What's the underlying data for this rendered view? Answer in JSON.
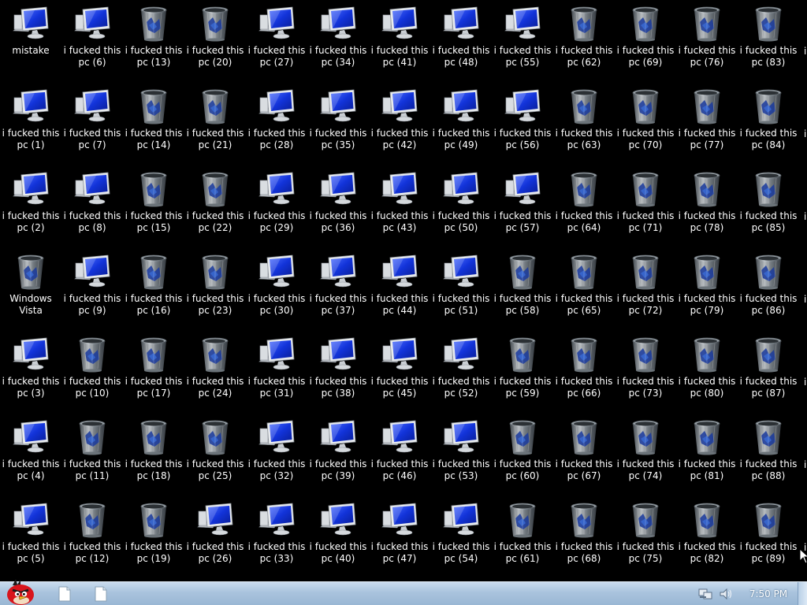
{
  "desktop": {
    "icons": [
      [
        "mistake",
        "i fucked this pc (1)",
        "i fucked this pc (2)",
        "Windows Vista",
        "i fucked this pc (3)",
        "i fucked this pc (4)",
        "i fucked this pc (5)"
      ],
      [
        "i fucked this pc (6)",
        "i fucked this pc (7)",
        "i fucked this pc (8)",
        "i fucked this pc (9)",
        "i fucked this pc (10)",
        "i fucked this pc (11)",
        "i fucked this pc (12)"
      ],
      [
        "i fucked this pc (13)",
        "i fucked this pc (14)",
        "i fucked this pc (15)",
        "i fucked this pc (16)",
        "i fucked this pc (17)",
        "i fucked this pc (18)",
        "i fucked this pc (19)"
      ],
      [
        "i fucked this pc (20)",
        "i fucked this pc (21)",
        "i fucked this pc (22)",
        "i fucked this pc (23)",
        "i fucked this pc (24)",
        "i fucked this pc (25)",
        "i fucked this pc (26)"
      ],
      [
        "i fucked this pc (27)",
        "i fucked this pc (28)",
        "i fucked this pc (29)",
        "i fucked this pc (30)",
        "i fucked this pc (31)",
        "i fucked this pc (32)",
        "i fucked this pc (33)"
      ],
      [
        "i fucked this pc (34)",
        "i fucked this pc (35)",
        "i fucked this pc (36)",
        "i fucked this pc (37)",
        "i fucked this pc (38)",
        "i fucked this pc (39)",
        "i fucked this pc (40)"
      ],
      [
        "i fucked this pc (41)",
        "i fucked this pc (42)",
        "i fucked this pc (43)",
        "i fucked this pc (44)",
        "i fucked this pc (45)",
        "i fucked this pc (46)",
        "i fucked this pc (47)"
      ],
      [
        "i fucked this pc (48)",
        "i fucked this pc (49)",
        "i fucked this pc (50)",
        "i fucked this pc (51)",
        "i fucked this pc (52)",
        "i fucked this pc (53)",
        "i fucked this pc (54)"
      ],
      [
        "i fucked this pc (55)",
        "i fucked this pc (56)",
        "i fucked this pc (57)",
        "i fucked this pc (58)",
        "i fucked this pc (59)",
        "i fucked this pc (60)",
        "i fucked this pc (61)"
      ],
      [
        "i fucked this pc (62)",
        "i fucked this pc (63)",
        "i fucked this pc (64)",
        "i fucked this pc (65)",
        "i fucked this pc (66)",
        "i fucked this pc (67)",
        "i fucked this pc (68)"
      ],
      [
        "i fucked this pc (69)",
        "i fucked this pc (70)",
        "i fucked this pc (71)",
        "i fucked this pc (72)",
        "i fucked this pc (73)",
        "i fucked this pc (74)",
        "i fucked this pc (75)"
      ],
      [
        "i fucked this pc (76)",
        "i fucked this pc (77)",
        "i fucked this pc (78)",
        "i fucked this pc (79)",
        "i fucked this pc (80)",
        "i fucked this pc (81)",
        "i fucked this pc (82)"
      ],
      [
        "i fucked this pc (83)",
        "i fucked this pc (84)",
        "i fucked this pc (85)",
        "i fucked this pc (86)",
        "i fucked this pc (87)",
        "i fucked this pc (88)",
        "i fucked this pc (89)"
      ]
    ],
    "icon_types": [
      [
        "computer",
        "computer",
        "computer",
        "recycle-bin",
        "computer",
        "computer",
        "computer"
      ],
      [
        "computer",
        "computer",
        "computer",
        "computer",
        "recycle-bin",
        "recycle-bin",
        "recycle-bin"
      ],
      [
        "recycle-bin",
        "recycle-bin",
        "recycle-bin",
        "recycle-bin",
        "recycle-bin",
        "recycle-bin",
        "recycle-bin"
      ],
      [
        "recycle-bin",
        "recycle-bin",
        "recycle-bin",
        "recycle-bin",
        "recycle-bin",
        "recycle-bin",
        "computer"
      ],
      [
        "computer",
        "computer",
        "computer",
        "computer",
        "computer",
        "computer",
        "computer"
      ],
      [
        "computer",
        "computer",
        "computer",
        "computer",
        "computer",
        "computer",
        "computer"
      ],
      [
        "computer",
        "computer",
        "computer",
        "computer",
        "computer",
        "computer",
        "computer"
      ],
      [
        "computer",
        "computer",
        "computer",
        "computer",
        "computer",
        "computer",
        "computer"
      ],
      [
        "computer",
        "computer",
        "computer",
        "recycle-bin",
        "recycle-bin",
        "recycle-bin",
        "recycle-bin"
      ],
      [
        "recycle-bin",
        "recycle-bin",
        "recycle-bin",
        "recycle-bin",
        "recycle-bin",
        "recycle-bin",
        "recycle-bin"
      ],
      [
        "recycle-bin",
        "recycle-bin",
        "recycle-bin",
        "recycle-bin",
        "recycle-bin",
        "recycle-bin",
        "recycle-bin"
      ],
      [
        "recycle-bin",
        "recycle-bin",
        "recycle-bin",
        "recycle-bin",
        "recycle-bin",
        "recycle-bin",
        "recycle-bin"
      ],
      [
        "recycle-bin",
        "recycle-bin",
        "recycle-bin",
        "recycle-bin",
        "recycle-bin",
        "recycle-bin",
        "recycle-bin"
      ]
    ],
    "edge_labels": [
      "i",
      "i",
      "i",
      "i",
      "i",
      "i",
      "i"
    ]
  },
  "taskbar": {
    "start_icon": "angry-bird-red-icon",
    "pinned": [
      "document-icon",
      "document-icon"
    ],
    "tray_icons": [
      "network-icon",
      "volume-icon"
    ],
    "clock": "7:50 PM"
  },
  "colors": {
    "desktop": "#000000",
    "taskbar": "#a9c3dd",
    "monitor_screen": "#1f3fd6"
  }
}
